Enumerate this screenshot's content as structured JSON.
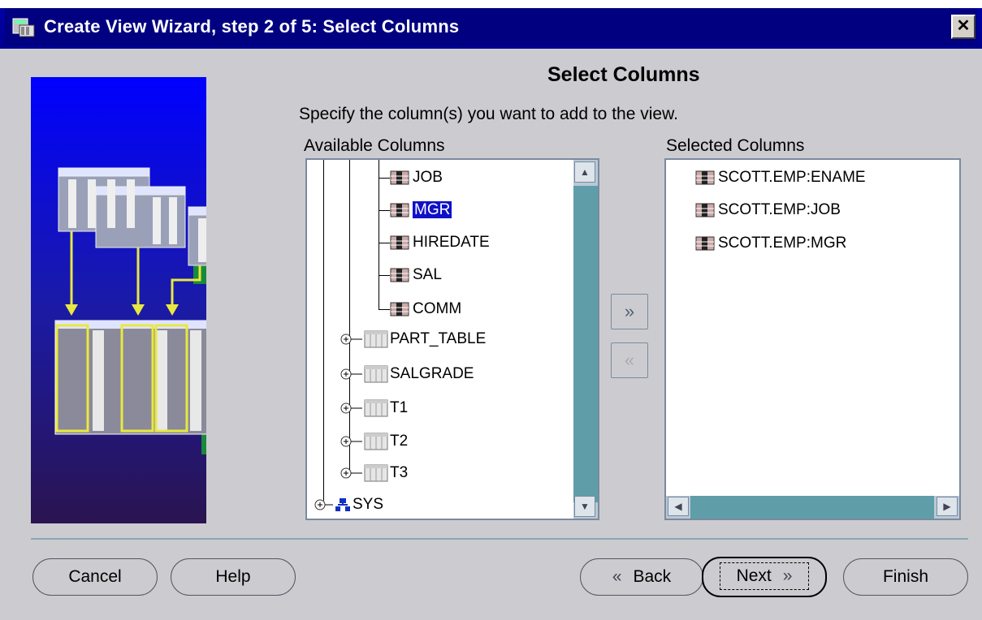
{
  "window": {
    "title": "Create View Wizard, step 2 of 5: Select Columns",
    "close_label": "✕"
  },
  "page": {
    "heading": "Select Columns",
    "instruction": "Specify the column(s) you want to add to the view."
  },
  "available": {
    "label": "Available Columns",
    "columns": [
      "JOB",
      "MGR",
      "HIREDATE",
      "SAL",
      "COMM"
    ],
    "selected_column": "MGR",
    "tables": [
      "PART_TABLE",
      "SALGRADE",
      "T1",
      "T2",
      "T3"
    ],
    "schema": "SYS"
  },
  "selected": {
    "label": "Selected Columns",
    "items": [
      "SCOTT.EMP:ENAME",
      "SCOTT.EMP:JOB",
      "SCOTT.EMP:MGR"
    ]
  },
  "move_buttons": {
    "add_glyph": "»",
    "remove_glyph": "«"
  },
  "buttons": {
    "cancel": "Cancel",
    "help": "Help",
    "back": "Back",
    "next": "Next",
    "finish": "Finish"
  },
  "colors": {
    "title_bar": "#000080",
    "selection": "#1010c8",
    "scroll_thumb": "#5f9ea8",
    "scroll_track": "#b9c9d6"
  }
}
